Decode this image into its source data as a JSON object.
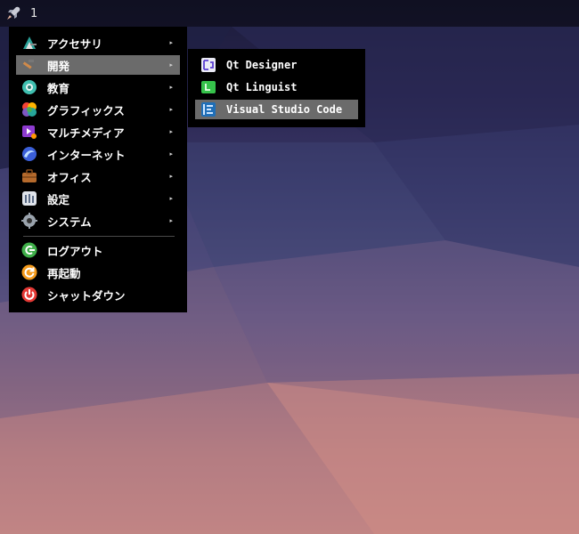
{
  "panel": {
    "workspace": "1",
    "launcher_icon": "rocket-icon"
  },
  "main_menu": {
    "items": [
      {
        "label": "アクセサリ",
        "icon": "accessories-icon",
        "submenu": true
      },
      {
        "label": "開発",
        "icon": "development-icon",
        "submenu": true,
        "active": true
      },
      {
        "label": "教育",
        "icon": "education-icon",
        "submenu": true
      },
      {
        "label": "グラフィックス",
        "icon": "graphics-icon",
        "submenu": true
      },
      {
        "label": "マルチメディア",
        "icon": "multimedia-icon",
        "submenu": true
      },
      {
        "label": "インターネット",
        "icon": "internet-icon",
        "submenu": true
      },
      {
        "label": "オフィス",
        "icon": "office-icon",
        "submenu": true
      },
      {
        "label": "設定",
        "icon": "settings-icon",
        "submenu": true
      },
      {
        "label": "システム",
        "icon": "system-icon",
        "submenu": true
      }
    ],
    "actions": [
      {
        "label": "ログアウト",
        "icon": "logout-icon"
      },
      {
        "label": "再起動",
        "icon": "reboot-icon"
      },
      {
        "label": "シャットダウン",
        "icon": "shutdown-icon"
      }
    ],
    "arrow": "▸"
  },
  "sub_menu": {
    "items": [
      {
        "label": "Qt Designer",
        "icon": "qt-designer-icon"
      },
      {
        "label": "Qt Linguist",
        "icon": "qt-linguist-icon"
      },
      {
        "label": "Visual Studio Code",
        "icon": "vscode-icon",
        "active": true
      }
    ]
  },
  "colors": {
    "menu_bg": "#000000",
    "highlight": "#6b6b6b",
    "panel_bg": "#08080e"
  }
}
